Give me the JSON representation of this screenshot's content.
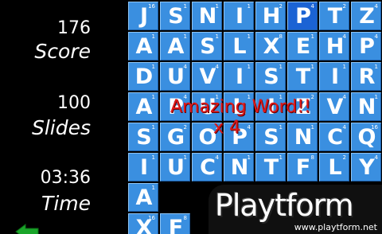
{
  "stats": {
    "score": {
      "value": "176",
      "label": "Score"
    },
    "slides": {
      "value": "100",
      "label": "Slides"
    },
    "time": {
      "value": "03:36",
      "label": "Time"
    }
  },
  "colors": {
    "tile": "#3a8fe0",
    "tile_selected": "#1b63d4",
    "message": "#e01818",
    "back_arrow": "#1aa52a"
  },
  "board": {
    "rows": [
      [
        {
          "l": "J",
          "p": "16"
        },
        {
          "l": "S",
          "p": "1"
        },
        {
          "l": "N",
          "p": "1"
        },
        {
          "l": "I",
          "p": "1"
        },
        {
          "l": "H",
          "p": "2"
        },
        {
          "l": "P",
          "p": "4",
          "selected": true
        },
        {
          "l": "T",
          "p": "2"
        },
        {
          "l": "Z",
          "p": "4"
        }
      ],
      [
        {
          "l": "A",
          "p": "1"
        },
        {
          "l": "A",
          "p": "1"
        },
        {
          "l": "S",
          "p": "1"
        },
        {
          "l": "L",
          "p": "1"
        },
        {
          "l": "X",
          "p": "8"
        },
        {
          "l": "E",
          "p": "1"
        },
        {
          "l": "H",
          "p": "4"
        },
        {
          "l": "P",
          "p": "4"
        }
      ],
      [
        {
          "l": "D",
          "p": "1"
        },
        {
          "l": "U",
          "p": "4"
        },
        {
          "l": "V",
          "p": "4"
        },
        {
          "l": "I",
          "p": "1"
        },
        {
          "l": "S",
          "p": "1"
        },
        {
          "l": "T",
          "p": "1"
        },
        {
          "l": "I",
          "p": "1"
        },
        {
          "l": "R",
          "p": "1"
        }
      ],
      [
        {
          "l": "A",
          "p": "1"
        },
        {
          "l": "P",
          "p": "4"
        },
        {
          "l": "U",
          "p": "1"
        },
        {
          "l": "L",
          "p": "1"
        },
        {
          "l": "I",
          "p": "1"
        },
        {
          "l": "Z",
          "p": "2"
        },
        {
          "l": "V",
          "p": "4"
        },
        {
          "l": "N",
          "p": "1"
        }
      ],
      [
        {
          "l": "S",
          "p": "1"
        },
        {
          "l": "G",
          "p": "2"
        },
        {
          "l": "O",
          "p": "1"
        },
        {
          "l": "P",
          "p": "4"
        },
        {
          "l": "S",
          "p": "1"
        },
        {
          "l": "N",
          "p": "1"
        },
        {
          "l": "C",
          "p": "4"
        },
        {
          "l": "Q",
          "p": "16"
        }
      ],
      [
        {
          "l": "I",
          "p": "1"
        },
        {
          "l": "U",
          "p": "1"
        },
        {
          "l": "C",
          "p": "4"
        },
        {
          "l": "N",
          "p": "1"
        },
        {
          "l": "T",
          "p": "1"
        },
        {
          "l": "F",
          "p": "8"
        },
        {
          "l": "L",
          "p": "2"
        },
        {
          "l": "Y",
          "p": "4"
        }
      ],
      [
        {
          "l": "A",
          "p": "1"
        }
      ],
      [
        {
          "l": "X",
          "p": "16"
        },
        {
          "l": "F",
          "p": "8"
        }
      ]
    ]
  },
  "message": {
    "main": "Amazing Word!!",
    "multiplier": "x 4"
  },
  "watermark": {
    "brand": "Playtform",
    "domain": "www.playtform.net"
  }
}
